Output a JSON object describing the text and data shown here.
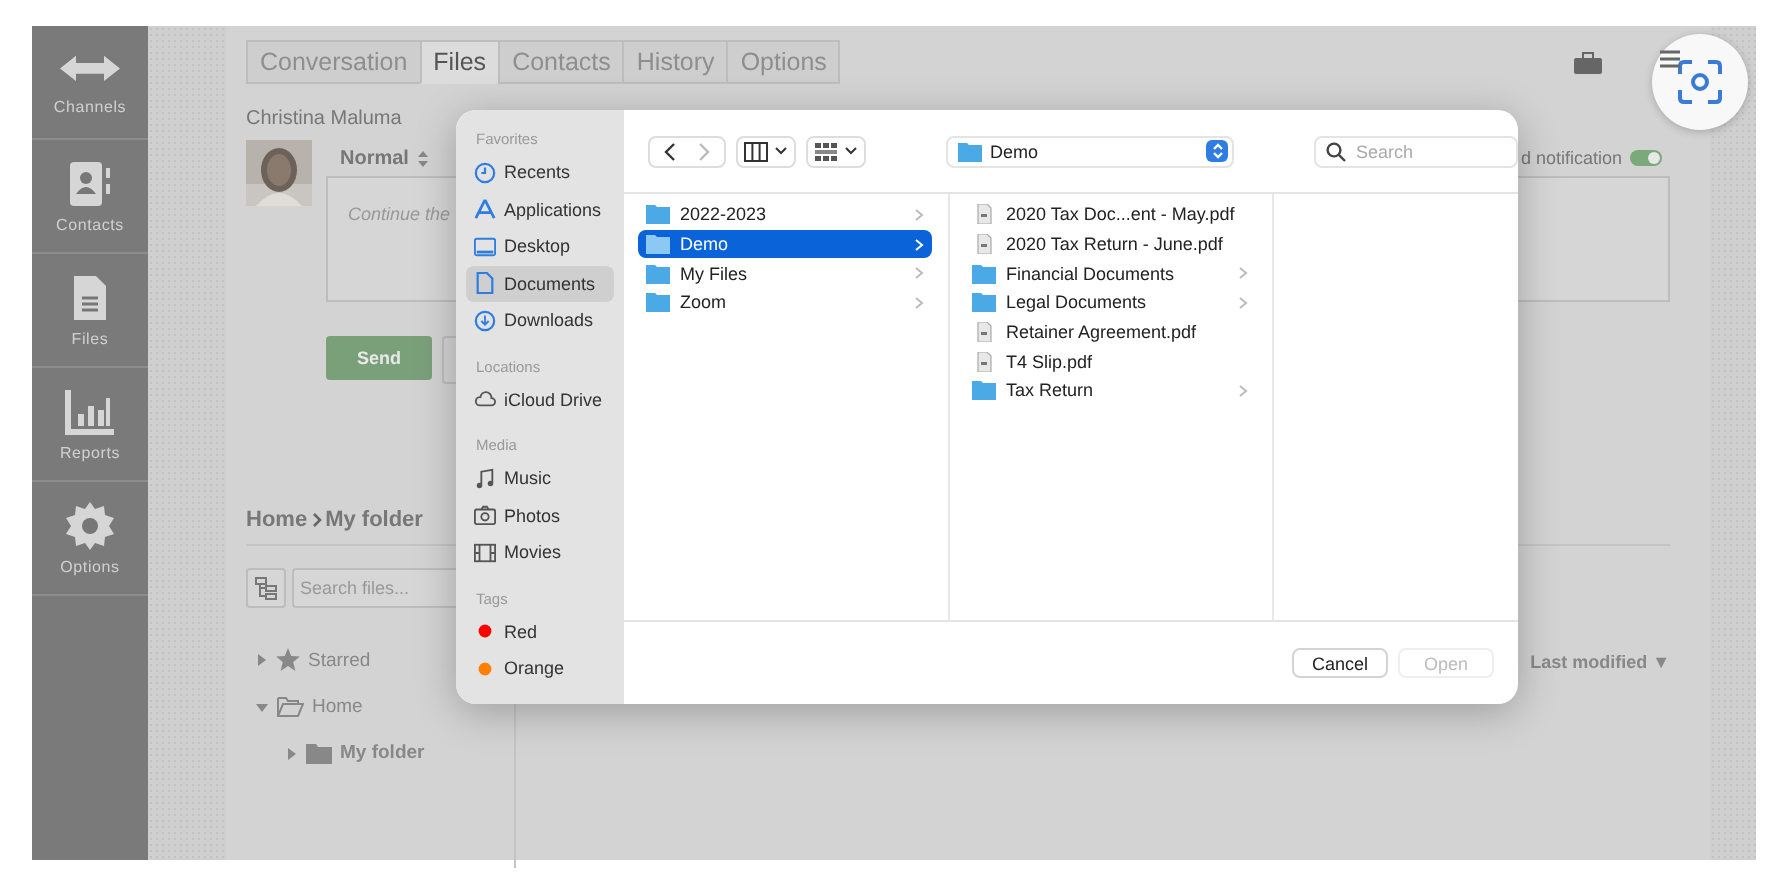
{
  "nav": [
    {
      "label": "Channels"
    },
    {
      "label": "Contacts"
    },
    {
      "label": "Files"
    },
    {
      "label": "Reports"
    },
    {
      "label": "Options"
    }
  ],
  "tabs": [
    {
      "label": "Conversation",
      "selected": false
    },
    {
      "label": "Files",
      "selected": true
    },
    {
      "label": "Contacts",
      "selected": false
    },
    {
      "label": "History",
      "selected": false
    },
    {
      "label": "Options",
      "selected": false
    }
  ],
  "contact_name": "Christina Maluma",
  "compose": {
    "format": "Normal",
    "placeholder": "Continue the",
    "notification": {
      "label": "d notification",
      "on": true
    },
    "send": "Send"
  },
  "breadcrumb": [
    "Home",
    "My folder"
  ],
  "file_search": {
    "placeholder": "Search files..."
  },
  "tree": [
    {
      "label": "Starred",
      "expanded": false
    },
    {
      "label": "Home",
      "expanded": true,
      "children": [
        {
          "label": "My folder",
          "expanded": false
        }
      ]
    }
  ],
  "sort": "Last modified ▼",
  "dialog": {
    "sidebar": [
      {
        "heading": "Favorites",
        "items": [
          {
            "label": "Recents",
            "selected": false
          },
          {
            "label": "Applications",
            "selected": false
          },
          {
            "label": "Desktop",
            "selected": false
          },
          {
            "label": "Documents",
            "selected": true
          },
          {
            "label": "Downloads",
            "selected": false
          }
        ]
      },
      {
        "heading": "Locations",
        "items": [
          {
            "label": "iCloud Drive",
            "selected": false
          }
        ]
      },
      {
        "heading": "Media",
        "items": [
          {
            "label": "Music",
            "selected": false
          },
          {
            "label": "Photos",
            "selected": false
          },
          {
            "label": "Movies",
            "selected": false
          }
        ]
      },
      {
        "heading": "Tags",
        "items": [
          {
            "label": "Red",
            "color": "#ff0000",
            "selected": false
          },
          {
            "label": "Orange",
            "color": "#ff8000",
            "selected": false
          }
        ]
      }
    ],
    "location": "Demo",
    "search": {
      "placeholder": "Search"
    },
    "columns": [
      [
        {
          "name": "2022-2023",
          "kind": "folder",
          "selected": false
        },
        {
          "name": "Demo",
          "kind": "folder",
          "selected": true
        },
        {
          "name": "My Files",
          "kind": "folder",
          "selected": false
        },
        {
          "name": "Zoom",
          "kind": "folder",
          "selected": false
        }
      ],
      [
        {
          "name": "2020 Tax Doc...ent - May.pdf",
          "kind": "file",
          "selected": false
        },
        {
          "name": "2020 Tax Return - June.pdf",
          "kind": "file",
          "selected": false
        },
        {
          "name": "Financial Documents",
          "kind": "folder",
          "selected": false
        },
        {
          "name": "Legal Documents",
          "kind": "folder",
          "selected": false
        },
        {
          "name": "Retainer Agreement.pdf",
          "kind": "file",
          "selected": false
        },
        {
          "name": "T4 Slip.pdf",
          "kind": "file",
          "selected": false
        },
        {
          "name": "Tax Return",
          "kind": "folder",
          "selected": false
        }
      ]
    ],
    "buttons": [
      {
        "label": "Cancel",
        "disabled": false
      },
      {
        "label": "Open",
        "disabled": true
      }
    ]
  }
}
